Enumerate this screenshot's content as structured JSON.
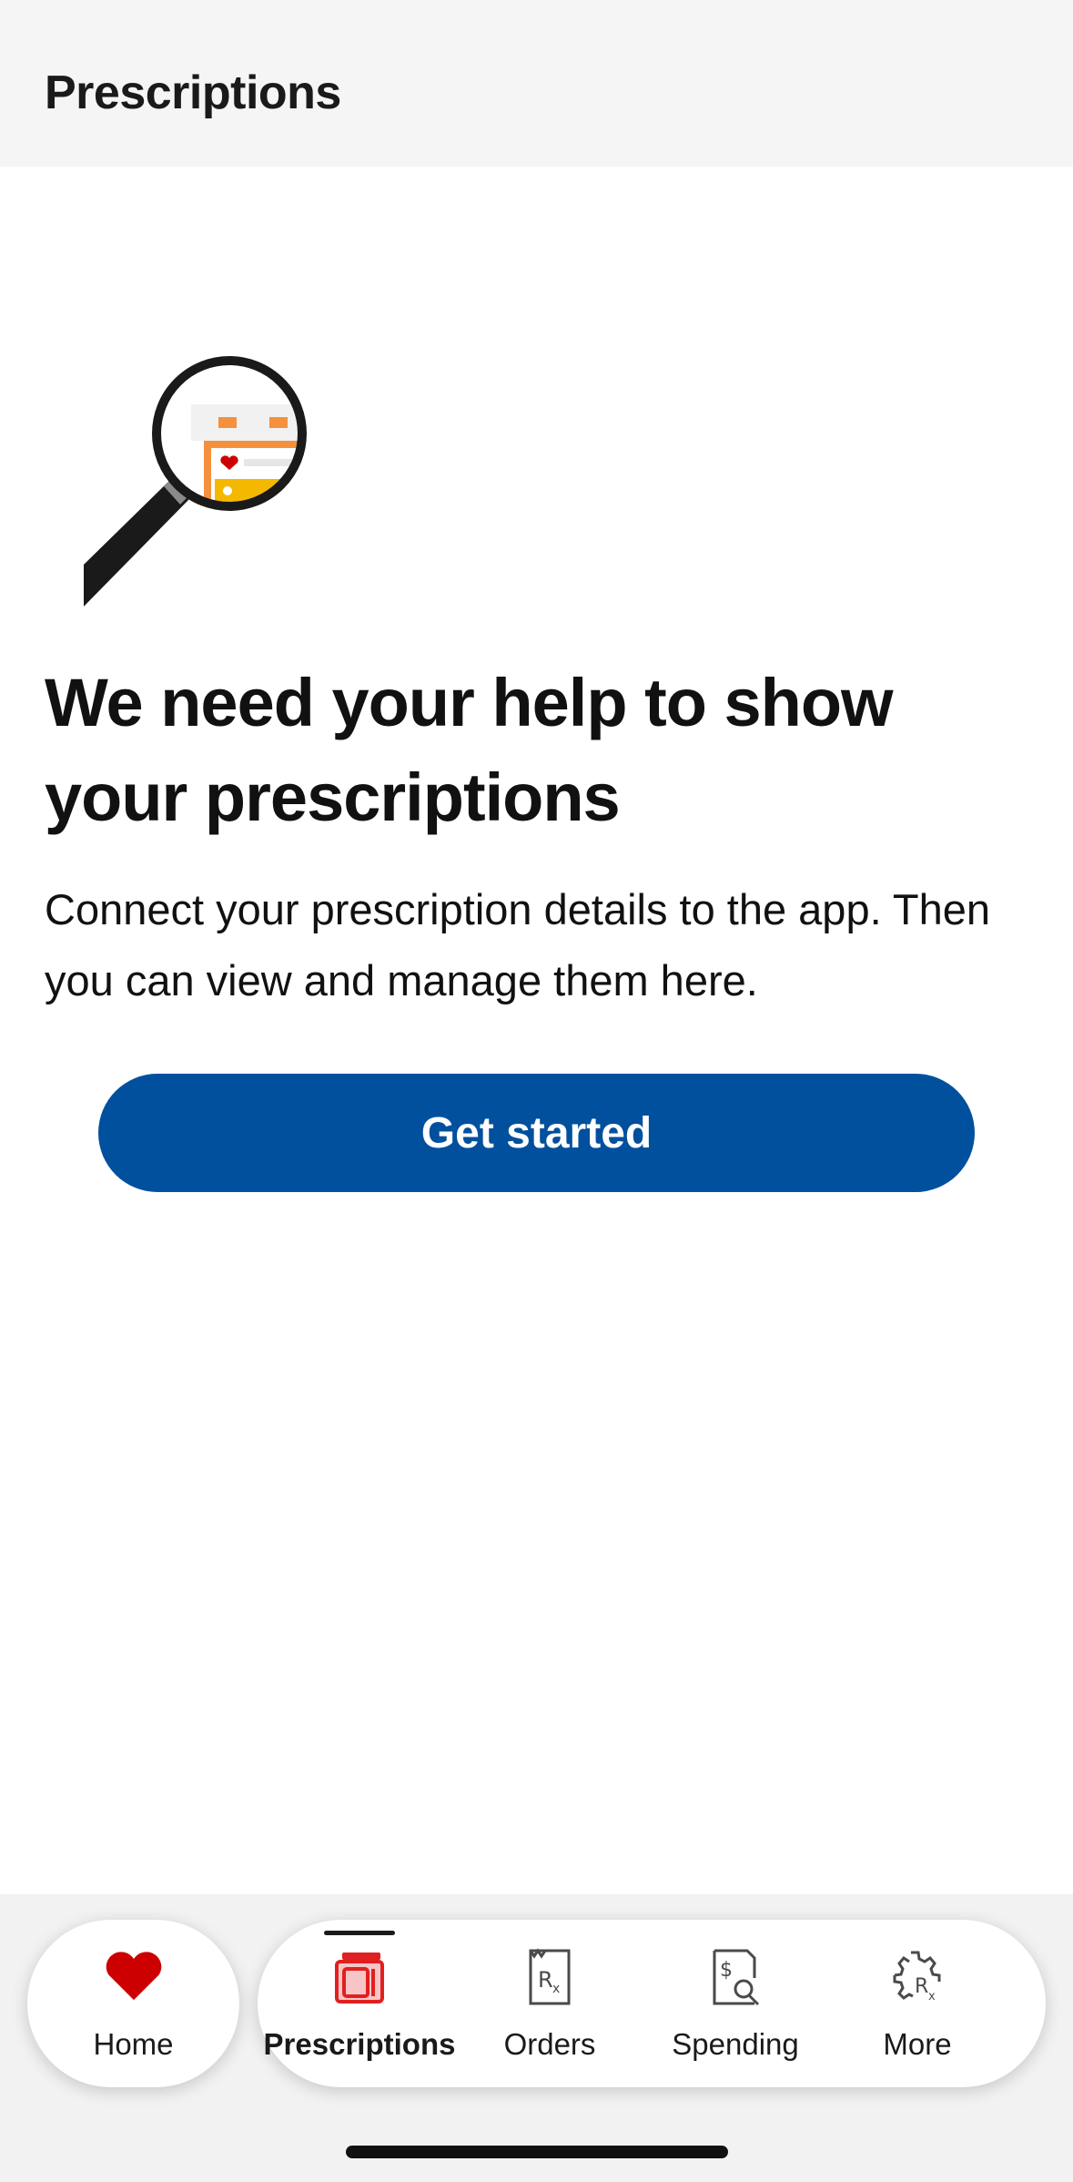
{
  "header": {
    "title": "Prescriptions"
  },
  "main": {
    "headline": "We need your help to show your prescriptions",
    "body": "Connect your prescription details to the app. Then you can view and manage them here.",
    "cta_label": "Get started"
  },
  "colors": {
    "primary_button": "#00509e",
    "brand_red": "#cc0000",
    "illustration_orange": "#f5913d",
    "illustration_yellow": "#f5b800"
  },
  "bottom_nav": {
    "active": "Prescriptions",
    "items": [
      {
        "label": "Home",
        "icon": "heart-icon"
      },
      {
        "label": "Prescriptions",
        "icon": "prescriptions-icon"
      },
      {
        "label": "Orders",
        "icon": "rx-receipt-icon"
      },
      {
        "label": "Spending",
        "icon": "dollar-search-icon"
      },
      {
        "label": "More",
        "icon": "gear-rx-icon"
      }
    ]
  }
}
